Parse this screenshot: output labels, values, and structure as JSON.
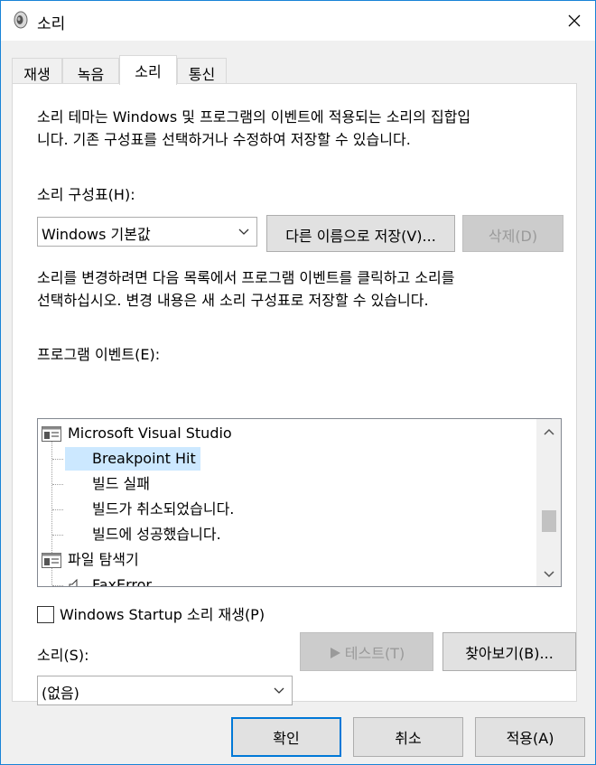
{
  "window": {
    "title": "소리",
    "icon": "speaker-icon",
    "close_icon": "close-icon"
  },
  "tabs": [
    {
      "label": "재생",
      "active": false
    },
    {
      "label": "녹음",
      "active": false
    },
    {
      "label": "소리",
      "active": true
    },
    {
      "label": "통신",
      "active": false
    }
  ],
  "panel": {
    "description_line1": "소리 테마는 Windows 및 프로그램의 이벤트에 적용되는 소리의 집합입",
    "description_line2": "니다. 기존 구성표를 선택하거나 수정하여 저장할 수 있습니다.",
    "scheme_label": "소리 구성표(H):",
    "scheme_value": "Windows 기본값",
    "save_as_button": "다른 이름으로 저장(V)...",
    "delete_button": "삭제(D)",
    "change_hint_line1": "소리를 변경하려면 다음 목록에서 프로그램 이벤트를 클릭하고 소리를",
    "change_hint_line2": "선택하십시오. 변경 내용은 새 소리 구성표로 저장할 수 있습니다.",
    "events_label": "프로그램 이벤트(E):",
    "events": [
      {
        "label": "Microsoft Visual Studio",
        "type": "group"
      },
      {
        "label": "Breakpoint Hit",
        "type": "item",
        "selected": true
      },
      {
        "label": "빌드 실패",
        "type": "item"
      },
      {
        "label": "빌드가 취소되었습니다.",
        "type": "item"
      },
      {
        "label": "빌드에 성공했습니다.",
        "type": "item"
      },
      {
        "label": "파일 탐색기",
        "type": "group"
      },
      {
        "label": "FaxError",
        "type": "item-with-sound"
      }
    ],
    "startup_checkbox_label": "Windows Startup 소리 재생(P)",
    "startup_checked": false,
    "sound_label": "소리(S):",
    "sound_value": "(없음)",
    "test_button": "테스트(T)",
    "browse_button": "찾아보기(B)..."
  },
  "footer": {
    "ok_button": "확인",
    "cancel_button": "취소",
    "apply_button": "적용(A)"
  },
  "colors": {
    "selection": "#cce8ff",
    "border_accent": "#0078d7",
    "disabled_text": "#9a9a9a"
  }
}
